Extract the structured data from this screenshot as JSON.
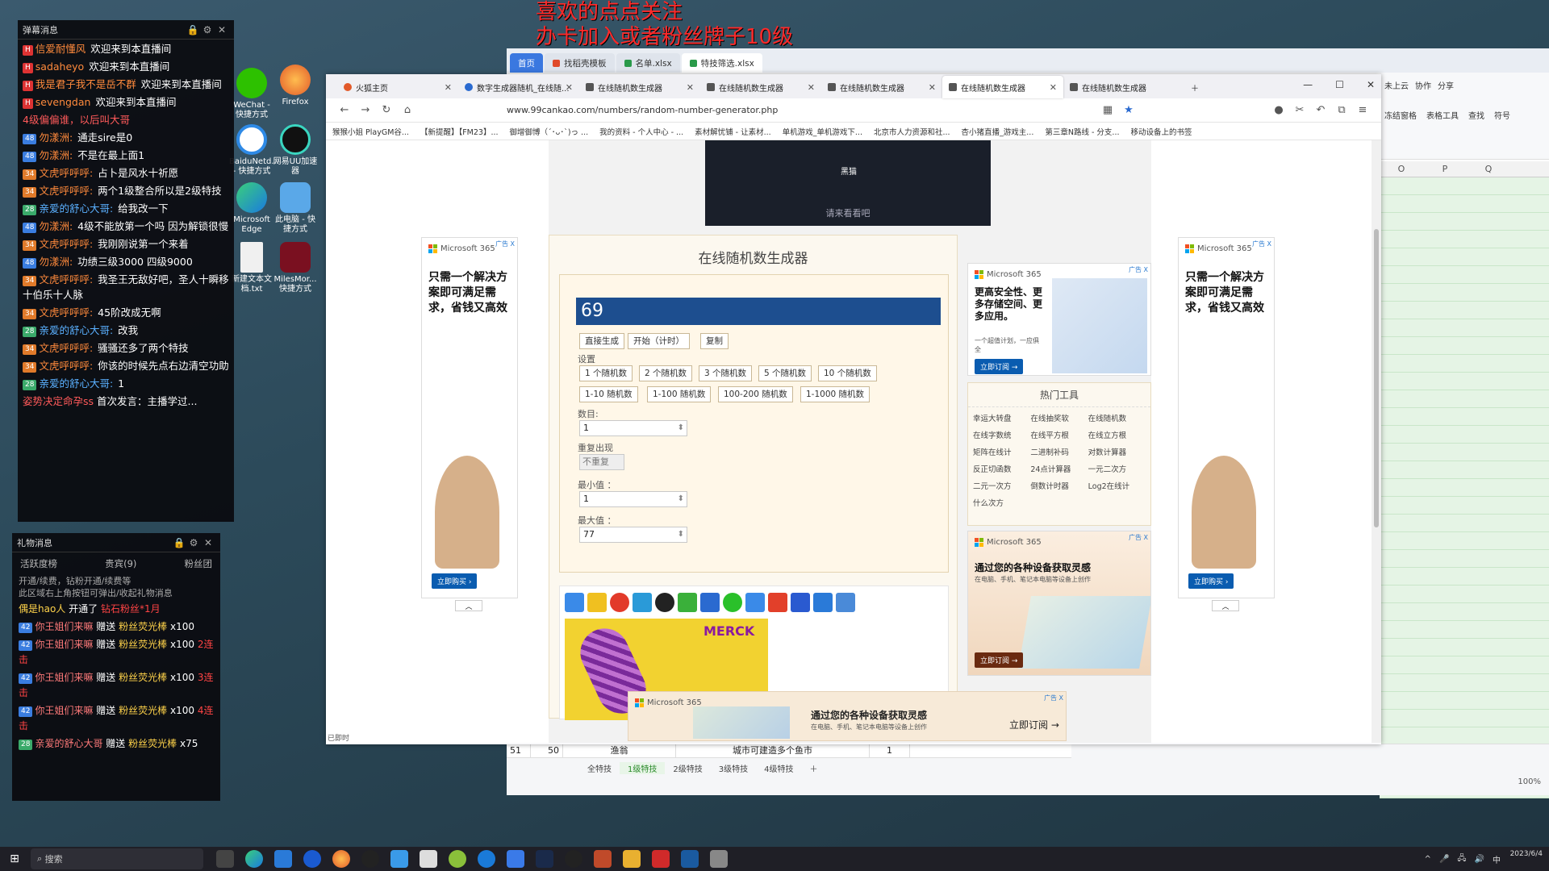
{
  "overlay": {
    "line1": "喜欢的点点关注",
    "line2": "办卡加入或者粉丝牌子10级"
  },
  "chat": {
    "title": "弹幕消息",
    "messages": [
      {
        "user": "信爱耐懂风",
        "text": "欢迎来到本直播间"
      },
      {
        "user": "sadaheyo",
        "text": "欢迎来到本直播间"
      },
      {
        "user": "我是君子我不是岳不群",
        "text": "欢迎来到本直播间"
      },
      {
        "user": "sevengdan",
        "text": "欢迎来到本直播间"
      },
      {
        "user": "",
        "text": "4级偏偏谁，以后叫大哥"
      },
      {
        "user": "勿漾洲:",
        "text": "通走sire是0"
      },
      {
        "user": "勿漾洲:",
        "text": "不是在最上面1"
      },
      {
        "user": "文虎呼呼呼:",
        "text": "占卜是风水十祈愿"
      },
      {
        "user": "文虎呼呼呼:",
        "text": "两个1级整合所以是2级特技"
      },
      {
        "user": "亲爱的舒心大哥:",
        "text": "给我改一下"
      },
      {
        "user": "勿漾洲:",
        "text": "4级不能放第一个吗 因为解锁很慢"
      },
      {
        "user": "文虎呼呼呼:",
        "text": "我刚刚说第一个来着"
      },
      {
        "user": "勿漾洲:",
        "text": "功绩三级3000 四级9000"
      },
      {
        "user": "文虎呼呼呼:",
        "text": "我圣王无敌好吧，圣人十瞬移十伯乐十人脉"
      },
      {
        "user": "文虎呼呼呼:",
        "text": "45阶改成无啊"
      },
      {
        "user": "亲爱的舒心大哥:",
        "text": "改我"
      },
      {
        "user": "文虎呼呼呼:",
        "text": "骚骚还多了两个特技"
      },
      {
        "user": "文虎呼呼呼:",
        "text": "你该的时候先点右边清空功助"
      },
      {
        "user": "亲爱的舒心大哥:",
        "text": "1"
      },
      {
        "user": "姿势决定命孕ss",
        "text": "首次发言：主播学过..."
      }
    ]
  },
  "gift": {
    "title": "礼物消息",
    "tabs": [
      "活跃度榜",
      "贵宾(9)",
      "粉丝团"
    ],
    "note1": "开通/续费，钻粉开通/续费等",
    "note2": "此区域右上角按钮可弹出/收起礼物消息",
    "lines": [
      {
        "user": "偶是hao人",
        "action": "开通了",
        "item": "钻石粉丝*1月"
      },
      {
        "user": "你王姐们来嘛",
        "action": "赠送",
        "item": "粉丝荧光棒",
        "count": "x100",
        "combo": ""
      },
      {
        "user": "你王姐们来嘛",
        "action": "赠送",
        "item": "粉丝荧光棒",
        "count": "x100",
        "combo": "2连击"
      },
      {
        "user": "你王姐们来嘛",
        "action": "赠送",
        "item": "粉丝荧光棒",
        "count": "x100",
        "combo": "3连击"
      },
      {
        "user": "你王姐们来嘛",
        "action": "赠送",
        "item": "粉丝荧光棒",
        "count": "x100",
        "combo": "4连击"
      },
      {
        "user": "亲爱的舒心大哥",
        "action": "赠送",
        "item": "粉丝荧光棒",
        "count": "x75",
        "combo": ""
      }
    ]
  },
  "desktop": {
    "icons": [
      "WeChat - 快捷方式",
      "Firefox",
      "BaiduNetd... - 快捷方式",
      "网易UU加速器",
      "Microsoft Edge",
      "此电脑 - 快捷方式",
      "新建文本文档.txt",
      "MilesMor... 快捷方式"
    ]
  },
  "sheet": {
    "tabs": [
      "首页",
      "找稻壳模板",
      "名单.xlsx",
      "特技筛选.xlsx"
    ],
    "cols": [
      "O",
      "P",
      "Q"
    ],
    "row51": {
      "num": "51",
      "b": "50",
      "c": "渔翁",
      "d": "城市可建造多个鱼市",
      "e": "1"
    },
    "sheet_tabs": [
      "全特技",
      "1级特技",
      "2级特技",
      "3级特技",
      "4级特技"
    ],
    "active_sheet": "1级特技",
    "zoom": "100%",
    "ribbon": [
      "未上云",
      "协作",
      "分享",
      "冻结窗格",
      "表格工具",
      "查找",
      "符号"
    ]
  },
  "browser": {
    "tabs": [
      "火狐主页",
      "数字生成器随机_在线随...",
      "在线随机数生成器",
      "在线随机数生成器",
      "在线随机数生成器",
      "在线随机数生成器",
      "在线随机数生成器"
    ],
    "active_tab": 5,
    "url": "www.99cankao.com/numbers/random-number-generator.php",
    "bookmarks": [
      "猴猴小姐 PlayGM谷...",
      "【新提醒】【FM23】...",
      "御增御博（´･ᴗ･`)っ ...",
      "我的资料 - 个人中心 - ...",
      "素材解忧铺 - 让素材...",
      "单机游戏_单机游戏下...",
      "北京市人力资源和社...",
      "杏小猪直播_游戏主...",
      "第三章N路线 - 分支...",
      "移动设备上的书签"
    ],
    "status": "已即时"
  },
  "tool": {
    "video_button": "黑猫",
    "video_caption": "请来看看吧",
    "title": "在线随机数生成器",
    "result": "69",
    "actions": [
      "直接生成",
      "开始（计时）",
      "复制"
    ],
    "settings_label": "设置",
    "count_presets": [
      "1 个随机数",
      "2 个随机数",
      "3 个随机数",
      "5 个随机数",
      "10 个随机数"
    ],
    "range_presets": [
      "1-10 随机数",
      "1-100 随机数",
      "100-200 随机数",
      "1-1000 随机数"
    ],
    "count_label": "数目:",
    "count_value": "1",
    "repeat_label": "重复出现",
    "repeat_value": "不重复",
    "min_label": "最小值 ：",
    "min_value": "1",
    "max_label": "最大值 ：",
    "max_value": "77"
  },
  "hot_tools": {
    "title": "热门工具",
    "items": [
      "幸运大转盘",
      "在线抽奖软",
      "在线随机数",
      "在线字数统",
      "在线平方根",
      "在线立方根",
      "矩阵在线计",
      "二进制补码",
      "对数计算器",
      "反正切函数",
      "24点计算器",
      "一元二次方",
      "二元一次方",
      "倒数计时器",
      "Log2在线计",
      "什么次方"
    ]
  },
  "ads": {
    "brand": "Microsoft 365",
    "left_text": "只需一个解决方案即可满足需求，省钱又高效",
    "left_cta": "立即购买 ›",
    "right_top_text": "更高安全性、更多存储空间、更多应用。",
    "right_top_sub": "一个超值计划，一应俱全",
    "right_top_cta": "立即订阅 →",
    "right_bottom_text": "通过您的各种设备获取灵感",
    "right_bottom_sub": "在电脑、手机、笔记本电脑等设备上创作",
    "right_bottom_cta": "立即订阅 →",
    "bottom_text": "通过您的各种设备获取灵感",
    "bottom_sub": "在电脑、手机、笔记本电脑等设备上创作",
    "bottom_cta": "立即订阅 →",
    "merck": "MERCK",
    "ad_tag": "广告 X"
  },
  "taskbar": {
    "search_placeholder": "搜索",
    "date": "2023/6/4"
  },
  "colors": {
    "accent": "#1d4e8f",
    "firefox": "#e25a2a",
    "sheet_green": "#e5f4e5"
  }
}
